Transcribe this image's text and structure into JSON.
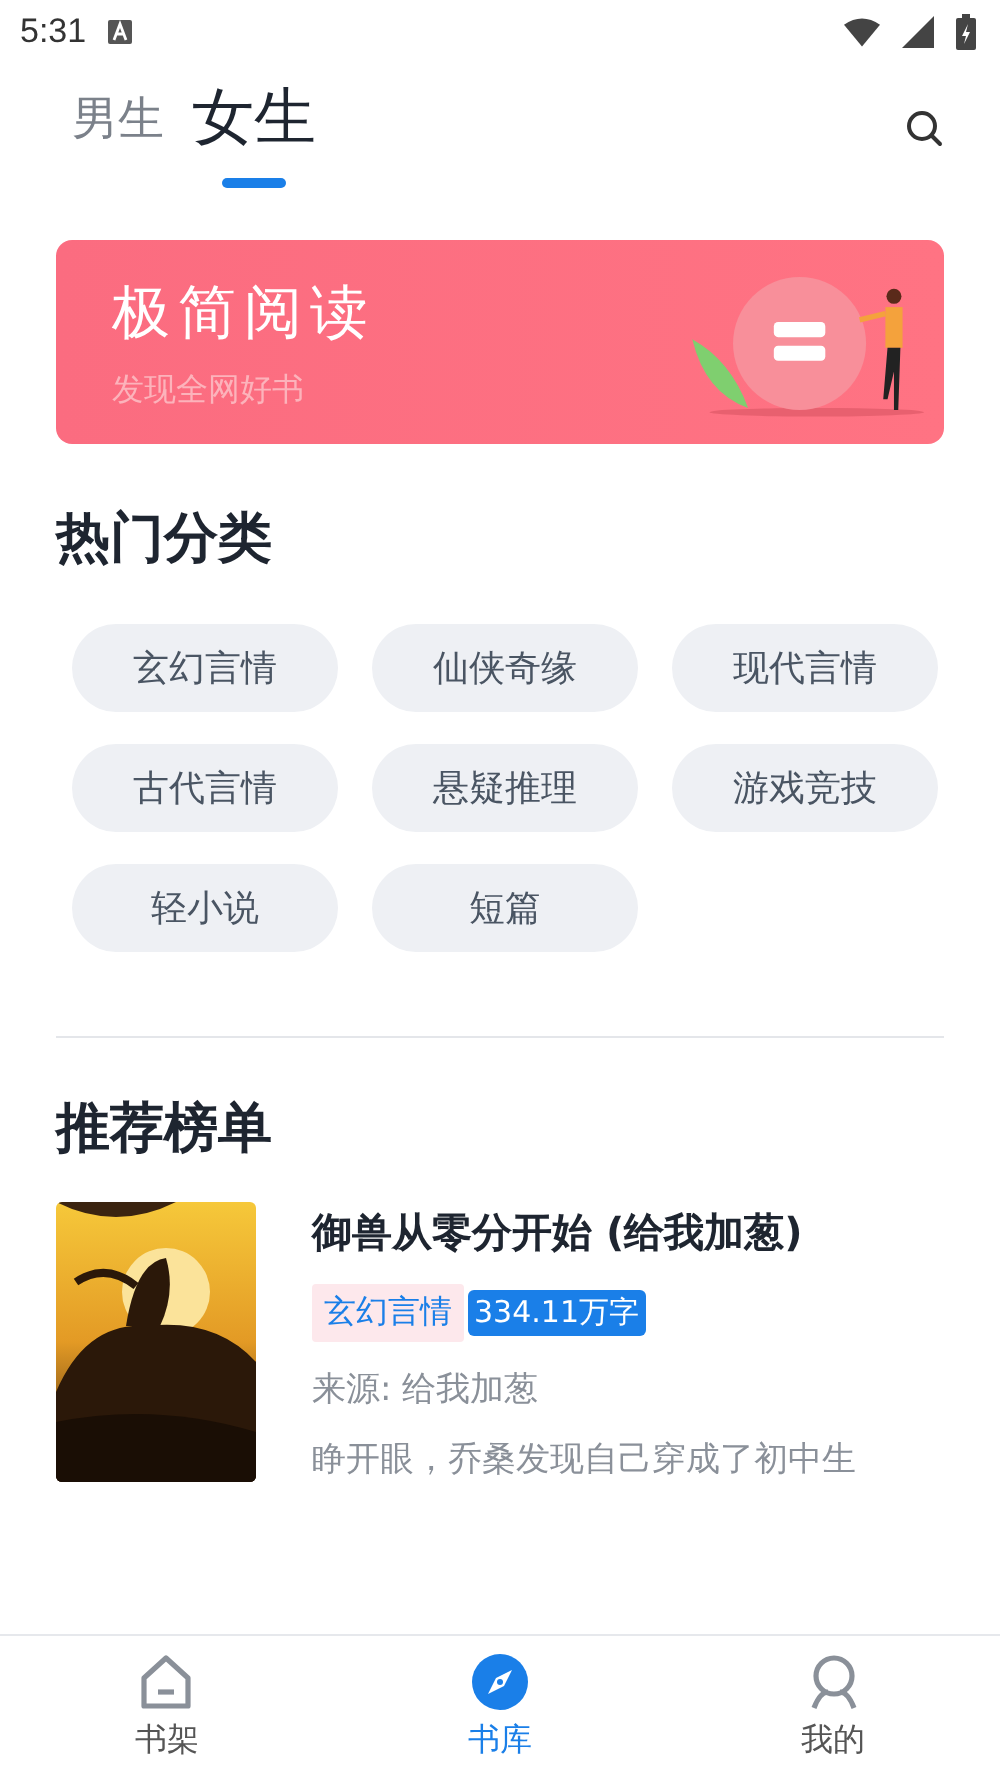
{
  "status_bar": {
    "time": "5:31"
  },
  "tabs": [
    {
      "label": "男生",
      "selected": false
    },
    {
      "label": "女生",
      "selected": true
    }
  ],
  "banner": {
    "title": "极简阅读",
    "subtitle": "发现全网好书"
  },
  "categories": {
    "title": "热门分类",
    "items": [
      "玄幻言情",
      "仙侠奇缘",
      "现代言情",
      "古代言情",
      "悬疑推理",
      "游戏竞技",
      "轻小说",
      "短篇"
    ]
  },
  "ranking": {
    "title": "推荐榜单",
    "books": [
      {
        "title": "御兽从零分开始 (给我加葱)",
        "genre": "玄幻言情",
        "words": "334.11万字",
        "source": "来源: 给我加葱",
        "intro": "睁开眼，乔桑发现自己穿成了初中生"
      }
    ]
  },
  "bottom_nav": [
    {
      "label": "书架",
      "kind": "shelf",
      "selected": false
    },
    {
      "label": "书库",
      "kind": "library",
      "selected": true
    },
    {
      "label": "我的",
      "kind": "profile",
      "selected": false
    }
  ]
}
